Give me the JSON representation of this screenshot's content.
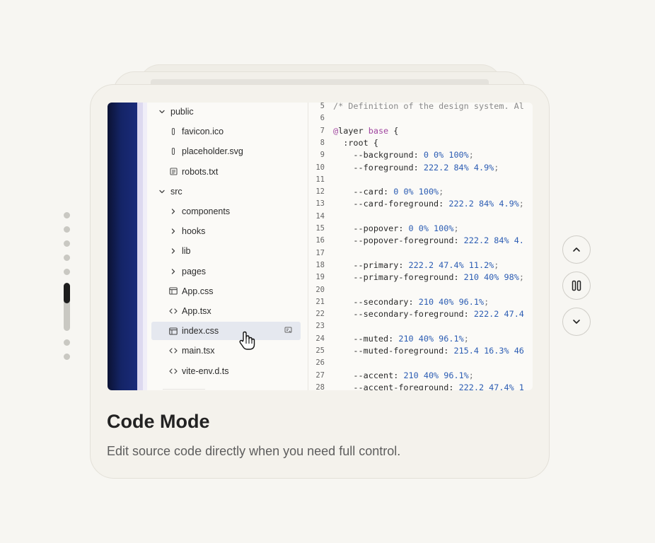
{
  "feature": {
    "title": "Code Mode",
    "description": "Edit source code directly when you need full control."
  },
  "tree": [
    {
      "label": "public",
      "icon": "chevron-down-icon",
      "indent": 0,
      "selected": false
    },
    {
      "label": "favicon.ico",
      "icon": "paperclip-icon",
      "indent": 1,
      "selected": false
    },
    {
      "label": "placeholder.svg",
      "icon": "paperclip-icon",
      "indent": 1,
      "selected": false
    },
    {
      "label": "robots.txt",
      "icon": "text-file-icon",
      "indent": 1,
      "selected": false
    },
    {
      "label": "src",
      "icon": "chevron-down-icon",
      "indent": 0,
      "selected": false
    },
    {
      "label": "components",
      "icon": "chevron-right-icon",
      "indent": 1,
      "selected": false
    },
    {
      "label": "hooks",
      "icon": "chevron-right-icon",
      "indent": 1,
      "selected": false
    },
    {
      "label": "lib",
      "icon": "chevron-right-icon",
      "indent": 1,
      "selected": false
    },
    {
      "label": "pages",
      "icon": "chevron-right-icon",
      "indent": 1,
      "selected": false
    },
    {
      "label": "App.css",
      "icon": "css-file-icon",
      "indent": 1,
      "selected": false
    },
    {
      "label": "App.tsx",
      "icon": "code-icon",
      "indent": 1,
      "selected": false
    },
    {
      "label": "index.css",
      "icon": "css-file-icon",
      "indent": 1,
      "selected": true
    },
    {
      "label": "main.tsx",
      "icon": "code-icon",
      "indent": 1,
      "selected": false
    },
    {
      "label": "vite-env.d.ts",
      "icon": "code-icon",
      "indent": 1,
      "selected": false
    }
  ],
  "code": [
    {
      "n": "5",
      "parts": [
        [
          "c",
          "/* Definition of the design system. Al"
        ]
      ]
    },
    {
      "n": "6",
      "parts": []
    },
    {
      "n": "7",
      "parts": [
        [
          "k",
          "@"
        ],
        [
          "t",
          "layer "
        ],
        [
          "k",
          "base"
        ],
        [
          "t",
          " {"
        ]
      ]
    },
    {
      "n": "8",
      "parts": [
        [
          "t",
          "  :root {"
        ]
      ]
    },
    {
      "n": "9",
      "parts": [
        [
          "t",
          "    --background: "
        ],
        [
          "v",
          "0 0% 100%"
        ],
        [
          "s",
          ";"
        ]
      ]
    },
    {
      "n": "10",
      "parts": [
        [
          "t",
          "    --foreground: "
        ],
        [
          "v",
          "222.2 84% 4.9%"
        ],
        [
          "s",
          ";"
        ]
      ]
    },
    {
      "n": "11",
      "parts": []
    },
    {
      "n": "12",
      "parts": [
        [
          "t",
          "    --card: "
        ],
        [
          "v",
          "0 0% 100%"
        ],
        [
          "s",
          ";"
        ]
      ]
    },
    {
      "n": "13",
      "parts": [
        [
          "t",
          "    --card-foreground: "
        ],
        [
          "v",
          "222.2 84% 4.9%"
        ],
        [
          "s",
          ";"
        ]
      ]
    },
    {
      "n": "14",
      "parts": []
    },
    {
      "n": "15",
      "parts": [
        [
          "t",
          "    --popover: "
        ],
        [
          "v",
          "0 0% 100%"
        ],
        [
          "s",
          ";"
        ]
      ]
    },
    {
      "n": "16",
      "parts": [
        [
          "t",
          "    --popover-foreground: "
        ],
        [
          "v",
          "222.2 84% 4."
        ]
      ]
    },
    {
      "n": "17",
      "parts": []
    },
    {
      "n": "18",
      "parts": [
        [
          "t",
          "    --primary: "
        ],
        [
          "v",
          "222.2 47.4% 11.2%"
        ],
        [
          "s",
          ";"
        ]
      ]
    },
    {
      "n": "19",
      "parts": [
        [
          "t",
          "    --primary-foreground: "
        ],
        [
          "v",
          "210 40% 98%"
        ],
        [
          "s",
          ";"
        ]
      ]
    },
    {
      "n": "20",
      "parts": []
    },
    {
      "n": "21",
      "parts": [
        [
          "t",
          "    --secondary: "
        ],
        [
          "v",
          "210 40% 96.1%"
        ],
        [
          "s",
          ";"
        ]
      ]
    },
    {
      "n": "22",
      "parts": [
        [
          "t",
          "    --secondary-foreground: "
        ],
        [
          "v",
          "222.2 47.4"
        ]
      ]
    },
    {
      "n": "23",
      "parts": []
    },
    {
      "n": "24",
      "parts": [
        [
          "t",
          "    --muted: "
        ],
        [
          "v",
          "210 40% 96.1%"
        ],
        [
          "s",
          ";"
        ]
      ]
    },
    {
      "n": "25",
      "parts": [
        [
          "t",
          "    --muted-foreground: "
        ],
        [
          "v",
          "215.4 16.3% 46"
        ]
      ]
    },
    {
      "n": "26",
      "parts": []
    },
    {
      "n": "27",
      "parts": [
        [
          "t",
          "    --accent: "
        ],
        [
          "v",
          "210 40% 96.1%"
        ],
        [
          "s",
          ";"
        ]
      ]
    },
    {
      "n": "28",
      "parts": [
        [
          "t",
          "    --accent-foreground: "
        ],
        [
          "v",
          "222.2 47.4% 1"
        ]
      ]
    }
  ],
  "carousel": {
    "slide_count": 8,
    "active_index": 5,
    "active_progress": 0.42
  },
  "controls": {
    "prev_icon": "chevron-up-icon",
    "pause_icon": "pause-icon",
    "next_icon": "chevron-down-icon"
  }
}
